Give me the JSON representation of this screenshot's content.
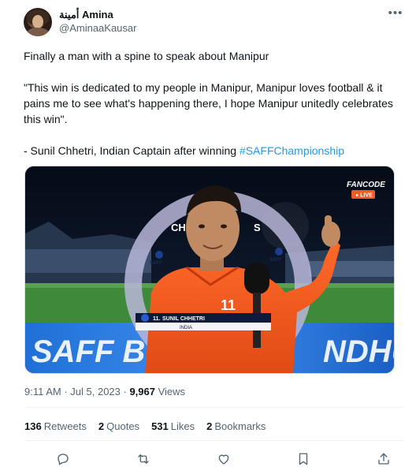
{
  "author": {
    "display_name": "أمينة Amina",
    "handle": "@AminaaKausar"
  },
  "tweet": {
    "line1": "Finally a man with a spine to speak about Manipur",
    "quote": "\"This win is dedicated to my people in Manipur, Manipur loves football & it pains me to see what's happening there, I hope Manipur unitedly celebrates this win\".",
    "attribution": "- Sunil Chhetri, Indian Captain after winning ",
    "hashtag": "#SAFFChampionship"
  },
  "media": {
    "broadcaster": "FANCODE",
    "live_label": "● LIVE",
    "lower_third_number": "11.",
    "lower_third_name": "SUNIL CHHETRI",
    "lower_third_team": "INDIA",
    "backdrop_text_left": "SAFF B",
    "backdrop_text_right": "NDHU",
    "ring_text": "CH",
    "ring_text_right": "S",
    "ring_logo_text": "SAFF",
    "jersey_number": "11"
  },
  "meta": {
    "time": "9:11 AM · Jul 5, 2023 · ",
    "views_count": "9,967",
    "views_label": " Views"
  },
  "stats": {
    "retweets_count": "136",
    "retweets_label": "Retweets",
    "quotes_count": "2",
    "quotes_label": "Quotes",
    "likes_count": "531",
    "likes_label": "Likes",
    "bookmarks_count": "2",
    "bookmarks_label": "Bookmarks"
  },
  "icons": {
    "more": "more-icon",
    "reply": "reply-icon",
    "retweet": "retweet-icon",
    "like": "heart-icon",
    "bookmark": "bookmark-icon",
    "share": "share-icon"
  },
  "colors": {
    "accent": "#1d9bf0",
    "text": "#0f1419",
    "muted": "#536471",
    "fancode_orange": "#f15a24"
  }
}
